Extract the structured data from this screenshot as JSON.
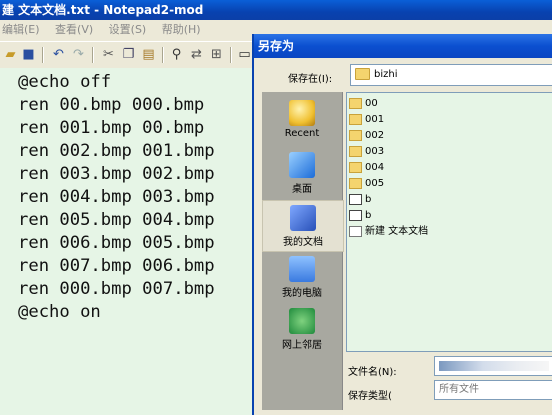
{
  "notepad": {
    "title": "建 文本文档.txt - Notepad2-mod",
    "menu": [
      "编辑(E)",
      "查看(V)",
      "设置(S)",
      "帮助(H)"
    ],
    "code_lines": [
      "@echo off",
      "ren 00.bmp 000.bmp",
      "ren 001.bmp 00.bmp",
      "ren 002.bmp 001.bmp",
      "ren 003.bmp 002.bmp",
      "ren 004.bmp 003.bmp",
      "ren 005.bmp 004.bmp",
      "ren 006.bmp 005.bmp",
      "ren 007.bmp 006.bmp",
      "ren 000.bmp 007.bmp",
      "@echo on"
    ]
  },
  "dialog": {
    "title": "另存为",
    "save_in_label": "保存在(I):",
    "save_in_value": "bizhi",
    "places": [
      "Recent",
      "桌面",
      "我的文档",
      "我的电脑",
      "网上邻居"
    ],
    "files": [
      {
        "name": "00",
        "icon": "folder-icon"
      },
      {
        "name": "001",
        "icon": "folder-icon"
      },
      {
        "name": "002",
        "icon": "folder-icon"
      },
      {
        "name": "003",
        "icon": "folder-icon"
      },
      {
        "name": "004",
        "icon": "folder-icon"
      },
      {
        "name": "005",
        "icon": "folder-icon"
      },
      {
        "name": "b",
        "icon": "image-file-icon"
      },
      {
        "name": "b",
        "icon": "image-file-icon"
      },
      {
        "name": "新建 文本文档",
        "icon": "text-file-icon"
      }
    ],
    "filename_label": "文件名(N):",
    "filetype_label": "保存类型(",
    "filetype_value": "所有文件"
  }
}
